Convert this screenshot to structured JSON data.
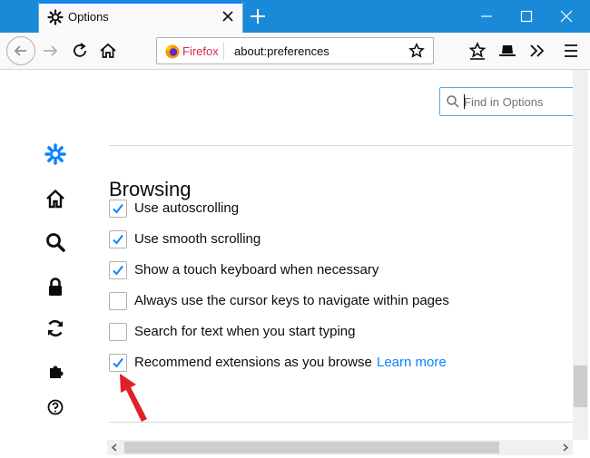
{
  "window": {
    "tab_title": "Options"
  },
  "navbar": {
    "identity_label": "Firefox",
    "url": "about:preferences"
  },
  "search": {
    "placeholder": "Find in Options"
  },
  "section": {
    "title": "Browsing"
  },
  "options": [
    {
      "label": "Use autoscrolling",
      "checked": true
    },
    {
      "label": "Use smooth scrolling",
      "checked": true
    },
    {
      "label": "Show a touch keyboard when necessary",
      "checked": true
    },
    {
      "label": "Always use the cursor keys to navigate within pages",
      "checked": false
    },
    {
      "label": "Search for text when you start typing",
      "checked": false
    },
    {
      "label": "Recommend extensions as you browse",
      "checked": true
    }
  ],
  "learn_more": "Learn more",
  "sidebar_icons": [
    "gear-icon",
    "home-icon",
    "search-icon",
    "lock-icon",
    "sync-icon",
    "puzzle-icon",
    "help-icon"
  ],
  "colors": {
    "titlebar": "#1a8ad8",
    "accent": "#0a84ff",
    "sidebar_active": "#0a84ff",
    "annotation_arrow": "#e0202a"
  }
}
